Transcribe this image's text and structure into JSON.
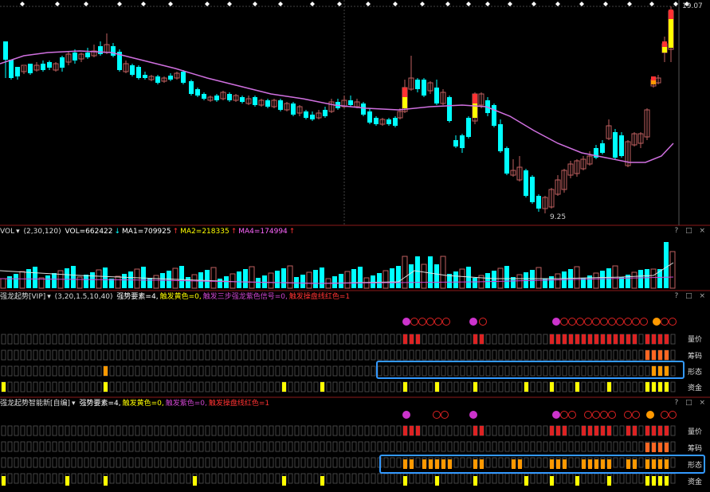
{
  "main": {
    "price_high": "19.07",
    "price_low": "9.25"
  },
  "vol": {
    "name": "VOL",
    "params": "(2,30,120)",
    "vol_text": "VOL=662422",
    "ma1_text": "MA1=709925",
    "ma2_text": "MA2=218335",
    "ma4_text": "MA4=174994",
    "controls": "? □ ×"
  },
  "panel1": {
    "name": "强龙起势[VIP]",
    "params": "(3,20,1.5,10,40)",
    "f1": "强势要素=4,",
    "f2": "触发黄色=0,",
    "f3": "触发三步强龙紫色信号=0,",
    "f4": "触发操盘线红色=1",
    "controls": "? □ ×",
    "row_labels": [
      "量价",
      "筹码",
      "形态",
      "资金"
    ]
  },
  "panel2": {
    "name": "强龙起势智能新[自编]",
    "f1": "强势要素=4,",
    "f2": "触发黄色=0,",
    "f3": "触发紫色=0,",
    "f4": "触发操盘线红色=1",
    "controls": "? □ ×",
    "row_labels": [
      "量价",
      "筹码",
      "形态",
      "资金"
    ]
  },
  "colors": {
    "up": "#ff3232",
    "down": "#00ffff",
    "ma": "#d070e0",
    "yellow": "#ffff00",
    "orange": "#ff9900",
    "purple": "#cc33cc",
    "highlight": "#3399ff"
  }
}
